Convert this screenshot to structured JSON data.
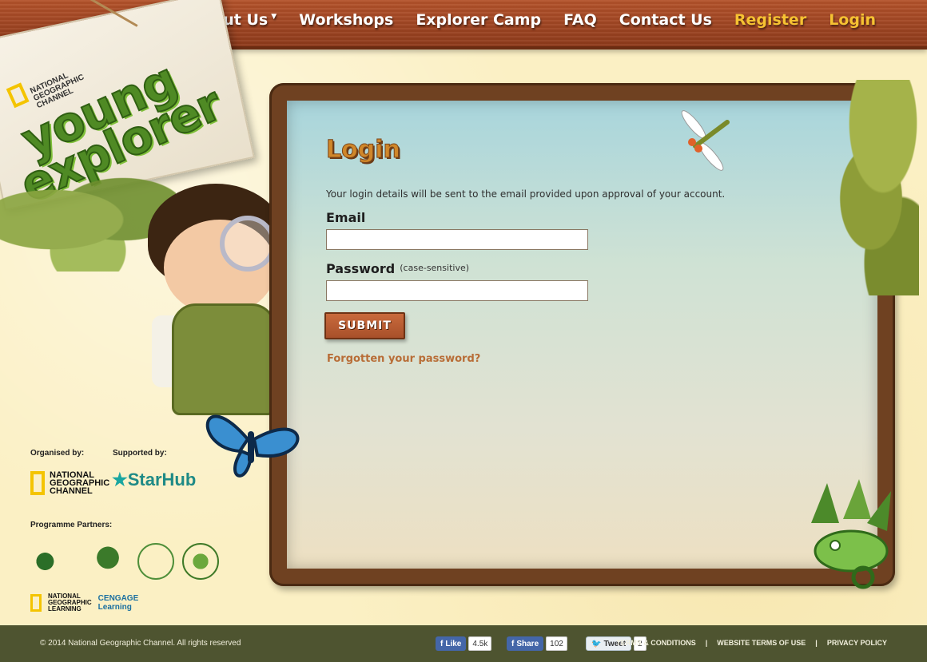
{
  "nav": {
    "items": [
      {
        "label": "About Us",
        "has_dropdown": true
      },
      {
        "label": "Workshops"
      },
      {
        "label": "Explorer Camp"
      },
      {
        "label": "FAQ"
      },
      {
        "label": "Contact Us"
      },
      {
        "label": "Register",
        "accent": true
      },
      {
        "label": "Login",
        "accent": true
      }
    ],
    "caret": "▼"
  },
  "logo": {
    "brand_line1": "NATIONAL",
    "brand_line2": "GEOGRAPHIC",
    "brand_line3": "CHANNEL",
    "word1": "young",
    "word2": "explorer"
  },
  "login": {
    "title": "Login",
    "note": "Your login details will be sent to the email provided upon approval of your account.",
    "email_label": "Email",
    "email_value": "",
    "password_label": "Password",
    "password_hint": "(case-sensitive)",
    "password_value": "",
    "submit_label": "SUBMIT",
    "forgot_label": "Forgotten your password?"
  },
  "sponsors": {
    "organised_by": "Organised by:",
    "supported_by": "Supported by:",
    "programme_partners": "Programme Partners:",
    "ng_line1": "NATIONAL",
    "ng_line2": "GEOGRAPHIC",
    "ng_line3": "CHANNEL",
    "starhub": "StarHub",
    "cengage_ng1": "NATIONAL",
    "cengage_ng2": "GEOGRAPHIC",
    "cengage_ng3": "LEARNING",
    "cengage1": "CENGAGE",
    "cengage2": "Learning"
  },
  "footer": {
    "copyright": "© 2014 National Geographic Channel. All rights reserved",
    "like_label": "Like",
    "like_count": "4.5k",
    "share_label": "Share",
    "share_count": "102",
    "tweet_label": "Tweet",
    "tweet_count": "2",
    "links": [
      "TERMS & CONDITIONS",
      "WEBSITE TERMS OF USE",
      "PRIVACY POLICY"
    ],
    "separator": "|"
  },
  "colors": {
    "nav_bg": "#9b4521",
    "accent": "#f6c232",
    "board_frame": "#6f4121",
    "footer_bg": "#4e5430",
    "submit_bg": "#b65a30"
  },
  "icons": [
    "caret-down-icon",
    "facebook-icon",
    "twitter-icon",
    "butterfly-icon",
    "dragonfly-icon",
    "chameleon-icon"
  ]
}
